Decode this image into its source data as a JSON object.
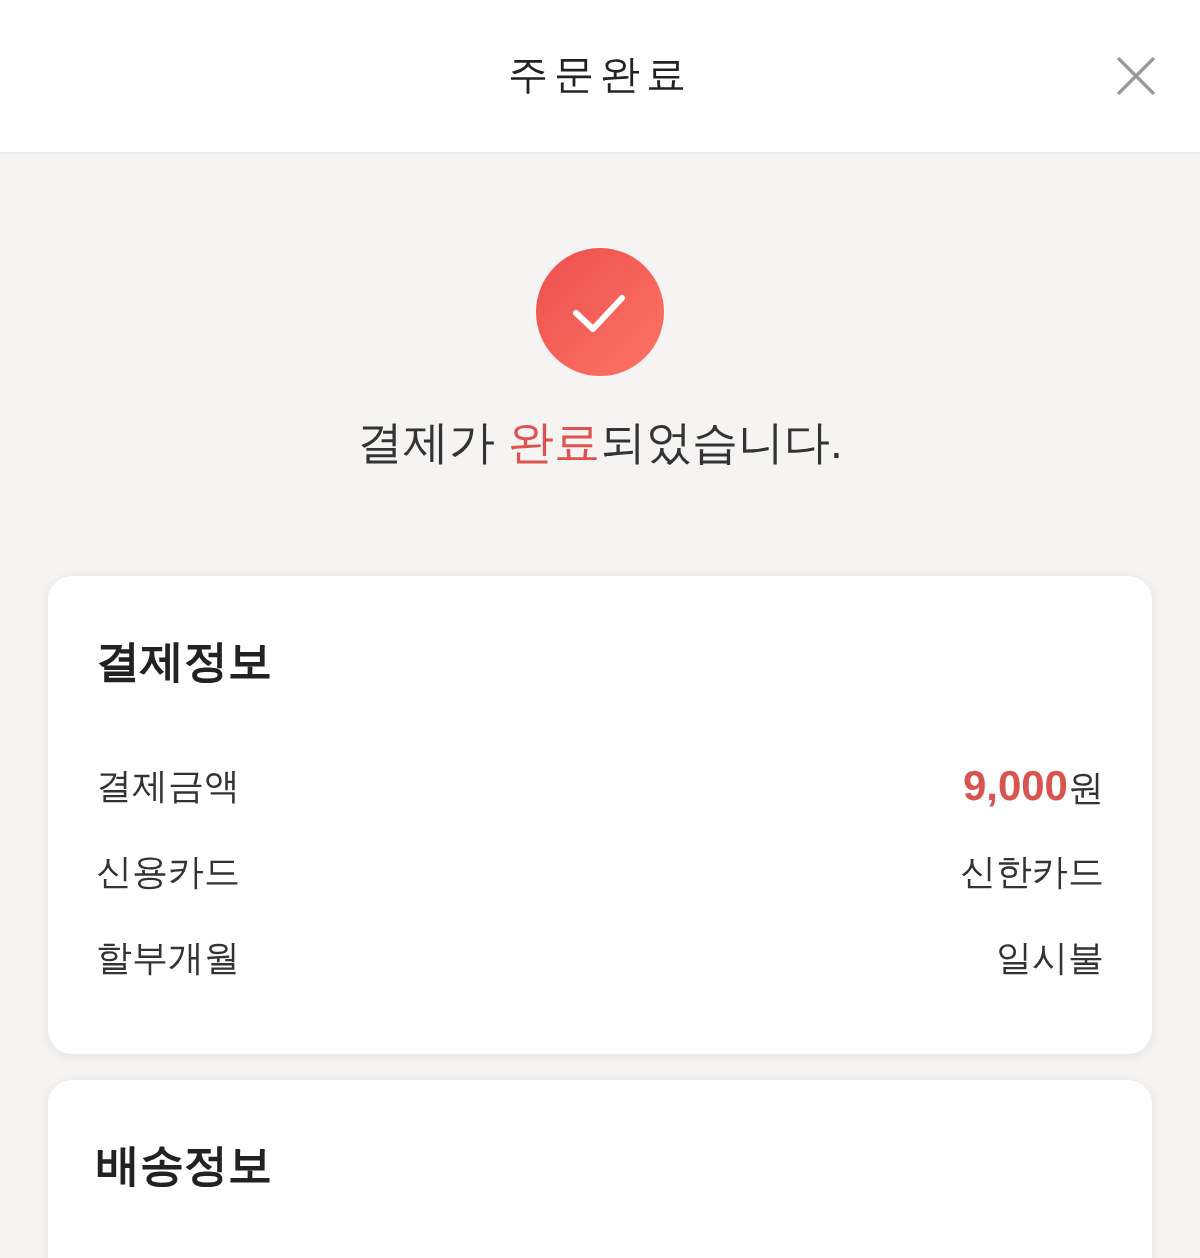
{
  "header": {
    "title": "주문완료"
  },
  "result": {
    "message": [
      {
        "text": "결제가 ",
        "highlight": false
      },
      {
        "text": "완료",
        "highlight": true
      },
      {
        "text": "되었습니다.",
        "highlight": false
      }
    ]
  },
  "cards": [
    {
      "title": "결제정보",
      "rows": [
        {
          "kind": "amount",
          "label": "결제금액",
          "value": "9,000",
          "unit": "원"
        },
        {
          "kind": "text",
          "label": "신용카드",
          "value": "신한카드"
        },
        {
          "kind": "text",
          "label": "할부개월",
          "value": "일시불"
        }
      ]
    },
    {
      "title": "배송정보"
    }
  ]
}
